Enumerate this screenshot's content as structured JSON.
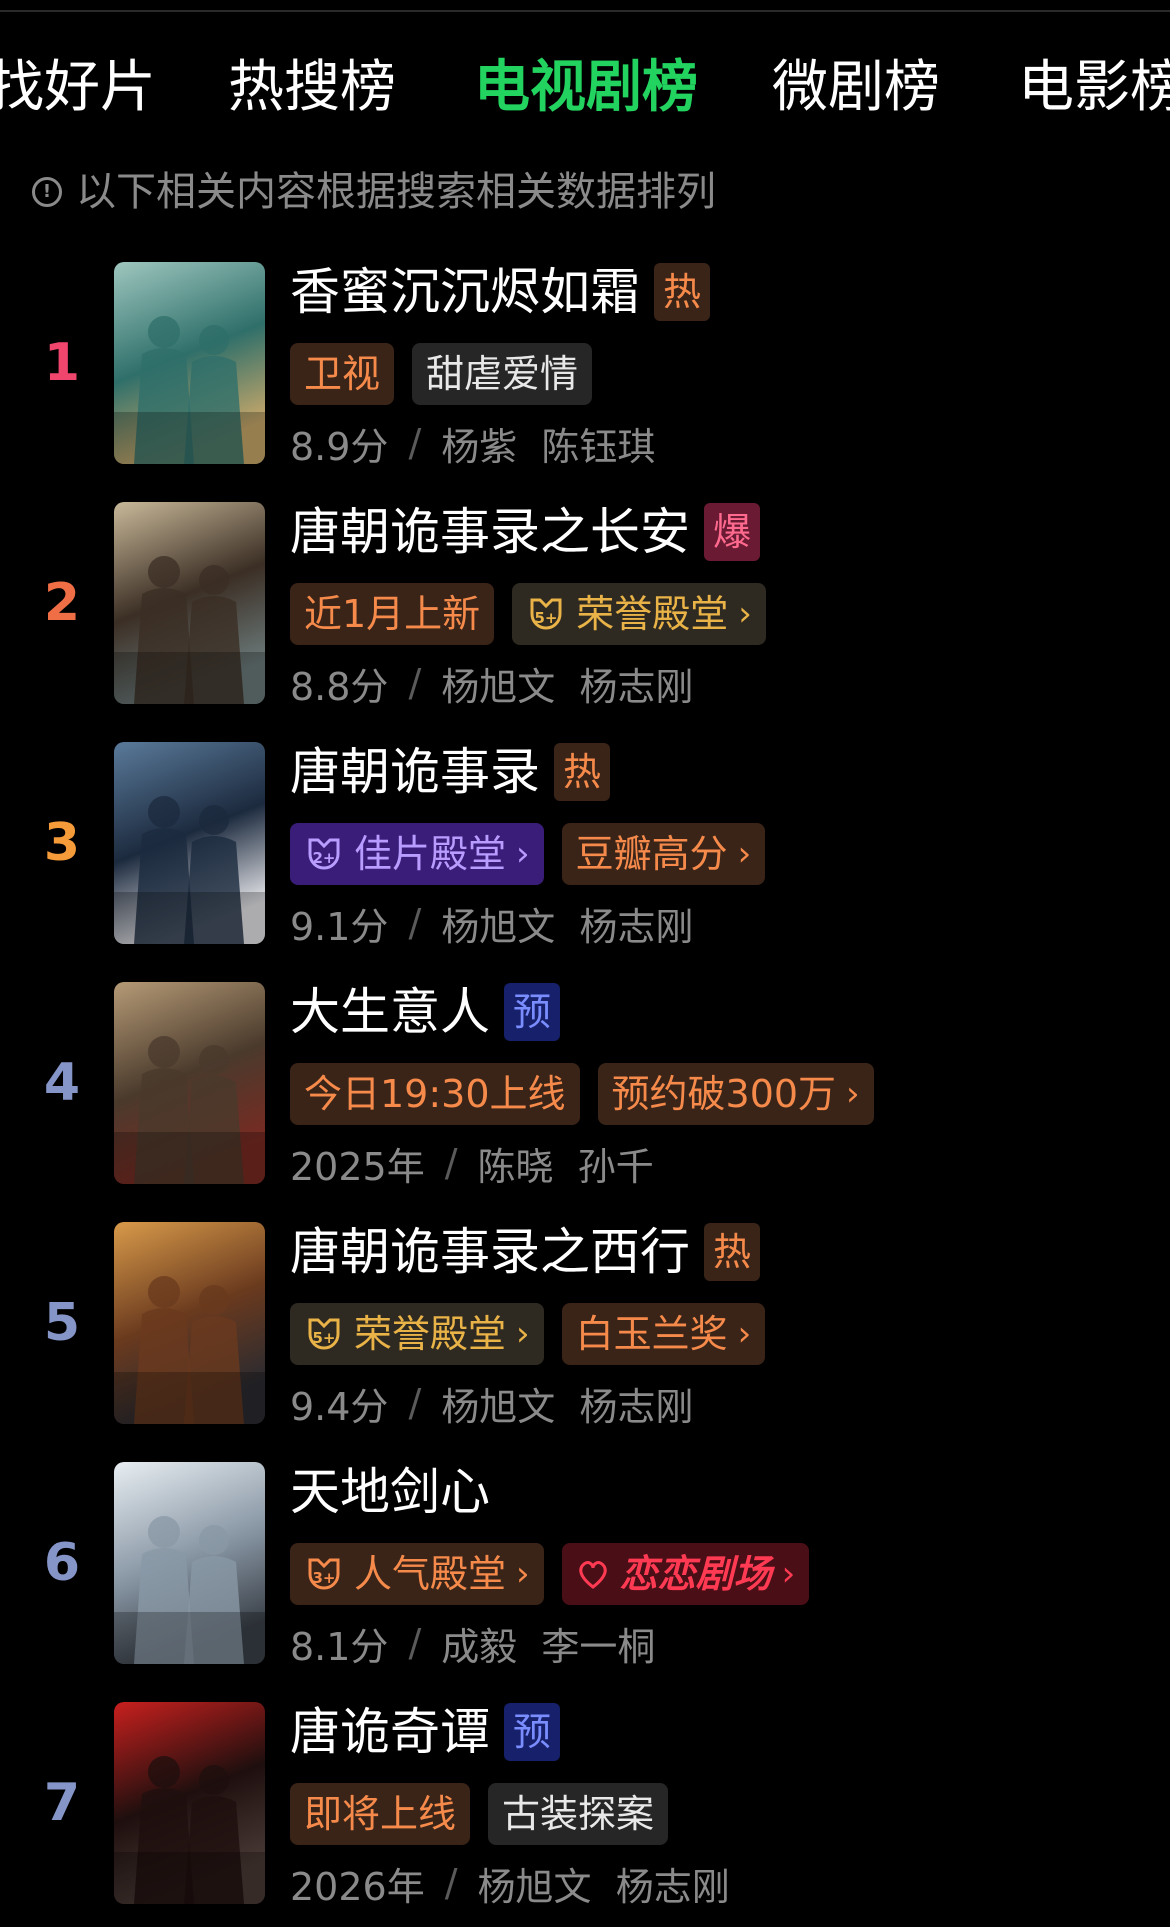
{
  "tabs": [
    {
      "label": "找好片",
      "active": false
    },
    {
      "label": "热搜榜",
      "active": false
    },
    {
      "label": "电视剧榜",
      "active": true
    },
    {
      "label": "微剧榜",
      "active": false
    },
    {
      "label": "电影榜",
      "active": false
    }
  ],
  "notice": {
    "icon": "exclamation-circle-icon",
    "text": "以下相关内容根据搜索相关数据排列"
  },
  "colors": {
    "active_tab": "#22d45f",
    "rank_1": "#f0466e",
    "rank_2": "#f06e46",
    "rank_3": "#f59b3a",
    "rank_other": "#8595c8"
  },
  "items": [
    {
      "rank": "1",
      "title": "香蜜沉沉烬如霜",
      "badge": {
        "text": "热",
        "kind": "hot"
      },
      "tags": [
        {
          "text": "卫视",
          "style": "orange",
          "link": false
        },
        {
          "text": "甜虐爱情",
          "style": "grey",
          "link": false
        }
      ],
      "score": "8.9分",
      "cast": "杨紫  陈钰琪",
      "poster_colors": [
        "#2f6f6a",
        "#9ec7bf",
        "#c9a86a"
      ]
    },
    {
      "rank": "2",
      "title": "唐朝诡事录之长安",
      "badge": {
        "text": "爆",
        "kind": "explode"
      },
      "tags": [
        {
          "text": "近1月上新",
          "style": "orange",
          "link": false
        },
        {
          "text": "荣誉殿堂",
          "style": "gold",
          "link": true,
          "icon": "medal-5-icon",
          "medal": "5"
        }
      ],
      "score": "8.8分",
      "cast": "杨旭文  杨志刚",
      "poster_colors": [
        "#3b2e24",
        "#c9b99a",
        "#6b7a7a"
      ]
    },
    {
      "rank": "3",
      "title": "唐朝诡事录",
      "badge": {
        "text": "热",
        "kind": "hot"
      },
      "tags": [
        {
          "text": "佳片殿堂",
          "style": "purple",
          "link": true,
          "icon": "medal-2-icon",
          "medal": "2"
        },
        {
          "text": "豆瓣高分",
          "style": "orange",
          "link": true
        }
      ],
      "score": "9.1分",
      "cast": "杨旭文  杨志刚",
      "poster_colors": [
        "#1c2a3e",
        "#5a7a9a",
        "#e6e6ea"
      ]
    },
    {
      "rank": "4",
      "title": "大生意人",
      "badge": {
        "text": "预",
        "kind": "pre"
      },
      "tags": [
        {
          "text": "今日19:30上线",
          "style": "orange",
          "link": false
        },
        {
          "text": "预约破300万",
          "style": "orange",
          "link": true
        }
      ],
      "score": "2025年",
      "cast": "陈晓  孙千",
      "poster_colors": [
        "#4a3a2c",
        "#b59a76",
        "#7a2a22"
      ]
    },
    {
      "rank": "5",
      "title": "唐朝诡事录之西行",
      "badge": {
        "text": "热",
        "kind": "hot"
      },
      "tags": [
        {
          "text": "荣誉殿堂",
          "style": "gold",
          "link": true,
          "icon": "medal-5-icon",
          "medal": "5"
        },
        {
          "text": "白玉兰奖",
          "style": "orange",
          "link": true
        }
      ],
      "score": "9.4分",
      "cast": "杨旭文  杨志刚",
      "poster_colors": [
        "#6a3a1e",
        "#d89a4a",
        "#2a2a30"
      ]
    },
    {
      "rank": "6",
      "title": "天地剑心",
      "badge": null,
      "tags": [
        {
          "text": "人气殿堂",
          "style": "orange",
          "link": true,
          "icon": "medal-3-icon",
          "medal": "3"
        },
        {
          "text": "恋恋剧场",
          "style": "red",
          "link": true,
          "icon": "heart-logo-icon"
        }
      ],
      "score": "8.1分",
      "cast": "成毅  李一桐",
      "poster_colors": [
        "#8a98a6",
        "#e8eef2",
        "#3a4048"
      ]
    },
    {
      "rank": "7",
      "title": "唐诡奇谭",
      "badge": {
        "text": "预",
        "kind": "pre"
      },
      "tags": [
        {
          "text": "即将上线",
          "style": "orange",
          "link": false
        },
        {
          "text": "古装探案",
          "style": "grey",
          "link": false
        }
      ],
      "score": "2026年",
      "cast": "杨旭文  杨志刚",
      "poster_colors": [
        "#1e0f0e",
        "#c8201e",
        "#4a3a36"
      ]
    }
  ]
}
